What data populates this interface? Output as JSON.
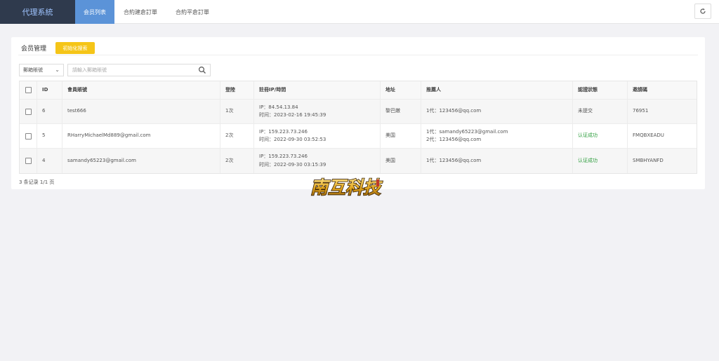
{
  "app": {
    "brand": "代理系統"
  },
  "nav": {
    "tabs": [
      {
        "label": "会员列表",
        "active": true
      },
      {
        "label": "合約建倉訂單",
        "active": false
      },
      {
        "label": "合約平倉訂單",
        "active": false
      }
    ],
    "refresh_icon": "refresh-icon"
  },
  "card": {
    "title": "会员管理",
    "init_search_label": "初始化搜索"
  },
  "filters": {
    "select_value": "郵箱賬號",
    "search_placeholder": "請輸入郵箱賬號",
    "search_icon": "search-icon"
  },
  "table": {
    "headers": [
      "ID",
      "會員賬號",
      "登陸",
      "註冊IP/時間",
      "地址",
      "推薦人",
      "認證狀態",
      "邀請碼"
    ],
    "rows": [
      {
        "id": "6",
        "account": "test666",
        "logins": "1次",
        "ip": "IP：84.54.13.84",
        "time": "时间：2023-02-16 19:45:39",
        "address": "黎巴嫩",
        "referrer1": "1代：123456@qq.com",
        "referrer2": "",
        "status": "未提交",
        "status_ok": false,
        "invite": "76951"
      },
      {
        "id": "5",
        "account": "RHarryMichaelMd889@gmail.com",
        "logins": "2次",
        "ip": "IP：159.223.73.246",
        "time": "时间：2022-09-30 03:52:53",
        "address": "美国",
        "referrer1": "1代：samandy65223@gmail.com",
        "referrer2": "2代：123456@qq.com",
        "status": "认证成功",
        "status_ok": true,
        "invite": "FMQBXEADU"
      },
      {
        "id": "4",
        "account": "samandy65223@gmail.com",
        "logins": "2次",
        "ip": "IP：159.223.73.246",
        "time": "时间：2022-09-30 03:15:39",
        "address": "美国",
        "referrer1": "1代：123456@qq.com",
        "referrer2": "",
        "status": "认证成功",
        "status_ok": true,
        "invite": "SMBHYANFD"
      }
    ]
  },
  "pagination": {
    "summary": "3 条记录 1/1 页"
  },
  "watermark": {
    "text": "南互科技"
  },
  "colors": {
    "brand_bg": "#2f3a4d",
    "active_tab": "#5b93d8",
    "init_button": "#f5c518",
    "status_ok": "#2e9e3e"
  }
}
